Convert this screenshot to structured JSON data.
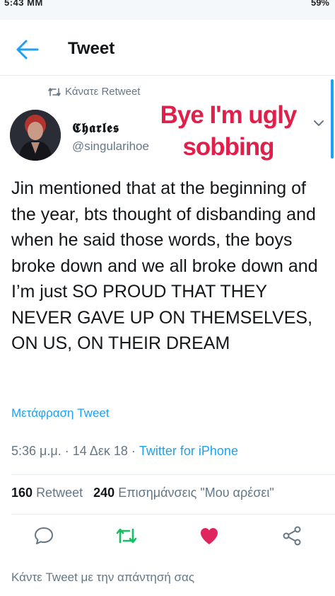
{
  "status_bar": {
    "time": "5:43 MM",
    "right": "59%"
  },
  "header": {
    "title": "Tweet"
  },
  "retweet_line": "Κάνατε Retweet",
  "user": {
    "display_name": "𝕮𝖍𝖆𝖗𝖑𝖊𝖘",
    "handle": "@singularihoe"
  },
  "overlay": {
    "line1": "Bye I'm ugly",
    "line2": "sobbing"
  },
  "tweet": {
    "text": "Jin mentioned that at the beginning of the year, bts thought of disbanding and when he said those words, the boys broke down and we all broke down and I’m just SO PROUD THAT THEY NEVER GAVE UP ON THEMSELVES, ON US, ON THEIR DREAM",
    "translate_label": "Μετάφραση Tweet",
    "time": "5:36 μ.μ.",
    "date": "14 Δεκ 18",
    "source": "Twitter for iPhone"
  },
  "counts": {
    "retweets_value": "160",
    "retweets_label": "Retweet",
    "likes_value": "240",
    "likes_label": "Επισημάνσεις \"Μου αρέσει\""
  },
  "actions": [
    "reply-icon",
    "retweet-icon",
    "like-icon",
    "share-icon"
  ],
  "reply_placeholder": "Κάντε Tweet με την απάντησή σας",
  "colors": {
    "accent": "#1da1f2",
    "retweet_active": "#17bf63",
    "like_active": "#e0245e",
    "overlay": "#e0204a"
  }
}
